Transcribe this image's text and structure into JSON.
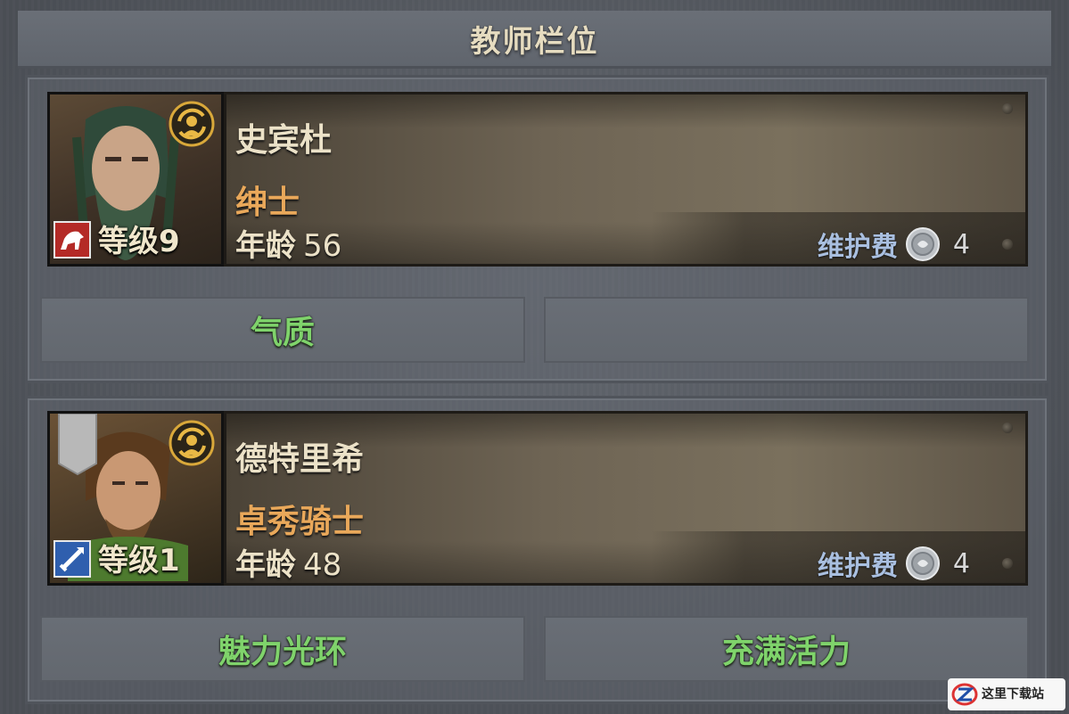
{
  "header": {
    "title": "教师栏位"
  },
  "teachers": [
    {
      "name": "史宾杜",
      "class_title": "绅士",
      "level_label": "等级9",
      "age_label": "年龄",
      "age_value": "56",
      "upkeep_label": "维护费",
      "upkeep_value": "4",
      "traits": [
        "气质",
        ""
      ]
    },
    {
      "name": "德特里希",
      "class_title": "卓秀骑士",
      "level_label": "等级1",
      "age_label": "年龄",
      "age_value": "48",
      "upkeep_label": "维护费",
      "upkeep_value": "4",
      "traits": [
        "魅力光环",
        "充满活力"
      ]
    }
  ],
  "colors": {
    "trait_text": "#7fd36b",
    "class_text": "#e9a85a",
    "upkeep_label": "#a9bfe0"
  },
  "icons": {
    "swap": "swap-icon",
    "coin": "silver-coin-icon",
    "badge1": "horse-icon",
    "badge2": "sword-icon"
  },
  "watermark": {
    "text": "这里下载站"
  }
}
